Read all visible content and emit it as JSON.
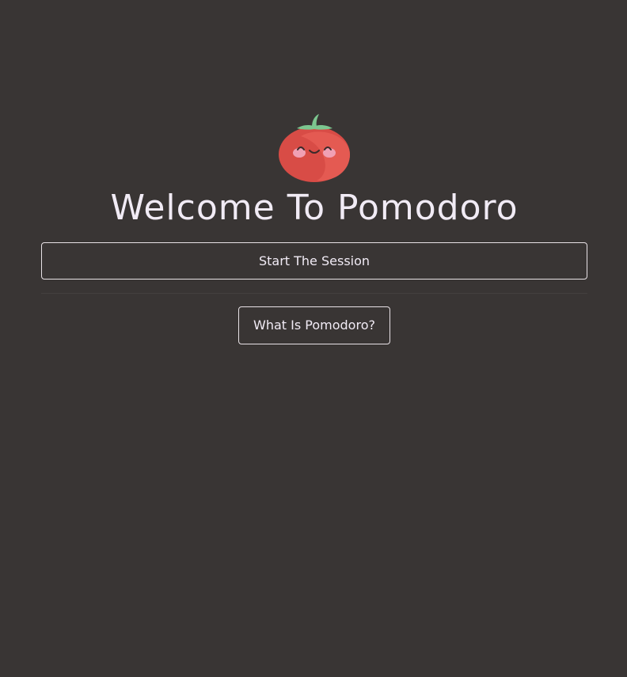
{
  "app": {
    "logo_icon": "tomato-mascot-icon",
    "title": "Welcome To Pomodoro"
  },
  "actions": {
    "start_label": "Start The Session",
    "info_label": "What Is Pomodoro?"
  },
  "colors": {
    "background": "#393534",
    "text": "#f1ebf5",
    "border": "#e8e2e6",
    "tomato": "#e0524d",
    "leaf": "#7cc68f",
    "cheeks": "#f0a0b4"
  }
}
